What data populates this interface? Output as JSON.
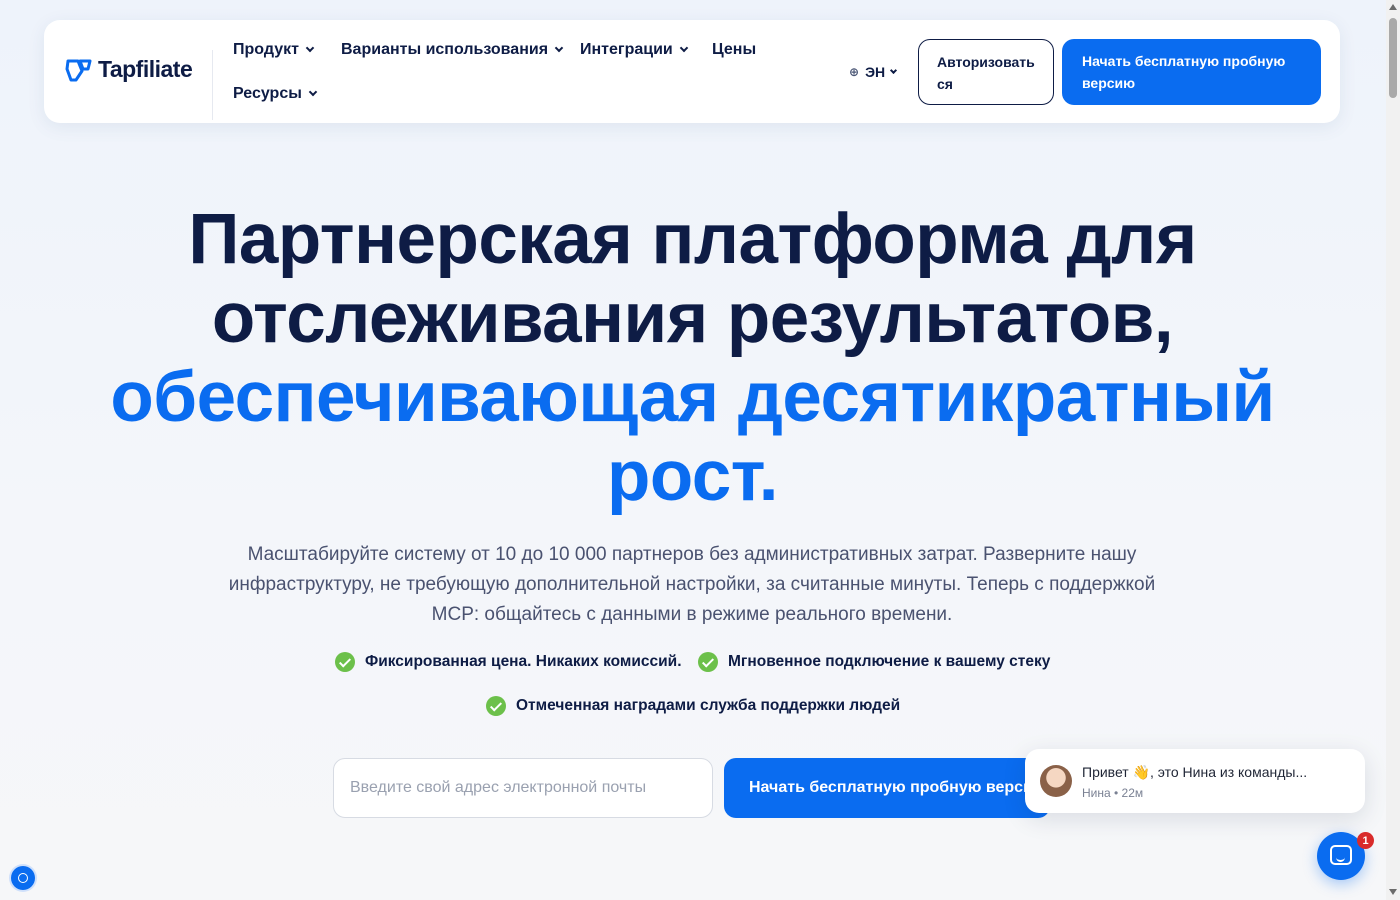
{
  "header": {
    "logo_text": "Tapfiliate",
    "nav": {
      "product": "Продукт",
      "use_cases": "Варианты использования",
      "integrations": "Интеграции",
      "pricing": "Цены",
      "resources": "Ресурсы"
    },
    "language": "ЭН",
    "login_label": "Авторизовать ся",
    "trial_label": "Начать бесплатную пробную версию"
  },
  "hero": {
    "title_line1": "Партнерская платформа для",
    "title_line2": "отслеживания результатов,",
    "title_accent_line1": "обеспечивающая десятикратный",
    "title_accent_line2": "рост.",
    "subtitle": "Масштабируйте систему от 10 до 10 000 партнеров без административных затрат. Разверните нашу инфраструктуру, не требующую дополнительной настройки, за считанные минуты. Теперь с поддержкой MCP: общайтесь с данными в режиме реального времени.",
    "features": [
      "Фиксированная цена. Никаких комиссий.",
      "Мгновенное подключение к вашему стеку",
      "Отмеченная наградами служба поддержки людей"
    ],
    "email_placeholder": "Введите свой адрес электронной почты",
    "cta_label": "Начать бесплатную пробную версию"
  },
  "chat": {
    "message": "Привет 👋, это Нина из команды...",
    "meta": "Нина • 22м",
    "badge_count": "1"
  },
  "colors": {
    "brand_blue": "#0a6cf0",
    "navy": "#0e1c45",
    "check_green": "#6cc04a"
  },
  "icons": [
    "tapfiliate-logo-icon",
    "chevron-down-icon",
    "globe-icon",
    "check-circle-icon",
    "chat-icon",
    "privacy-icon"
  ]
}
